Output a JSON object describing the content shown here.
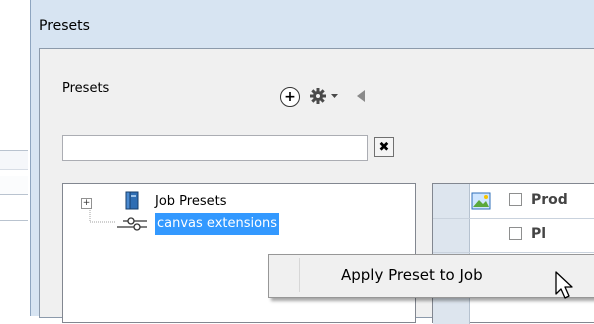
{
  "window": {
    "title": "Presets"
  },
  "panel": {
    "label": "Presets",
    "toolbar": {
      "add_icon": "plus-circle-icon",
      "settings_icon": "gear-icon",
      "collapse_icon": "triangle-left-icon"
    },
    "search": {
      "value": "",
      "clear_label": "✖"
    }
  },
  "tree": {
    "items": [
      {
        "label": "Job Presets",
        "icon": "book-icon",
        "expander": "+"
      },
      {
        "label": "canvas extensions",
        "icon": "slider-icon",
        "selected": true
      }
    ]
  },
  "grid": {
    "rows": [
      {
        "text": "Prod"
      },
      {
        "text": "Pl"
      }
    ]
  },
  "context_menu": {
    "items": [
      {
        "label": "Apply Preset to Job"
      }
    ]
  },
  "colors": {
    "selection": "#3399ff",
    "window_bg": "#d7e4f2",
    "panel_bg": "#f0f0f0"
  }
}
